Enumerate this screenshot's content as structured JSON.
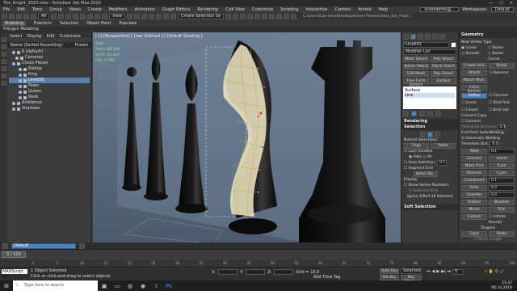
{
  "window": {
    "title": "The_Knight_2020.max - Autodesk 3ds Max 2020"
  },
  "menu": {
    "items": [
      "File",
      "Edit",
      "Tools",
      "Group",
      "Views",
      "Create",
      "Modifiers",
      "Animation",
      "Graph Editors",
      "Rendering",
      "Civil View",
      "Customize",
      "Scripting",
      "Interactive",
      "Content",
      "Arnold",
      "Help"
    ],
    "user": "andrewinfo@...",
    "workspaces_label": "Workspaces:",
    "workspace_value": "Default"
  },
  "toolbar": {
    "selection_filter": "All",
    "view_dropdown": "View",
    "create_sel_set": "Create Selection Se"
  },
  "ribbon": {
    "tabs": [
      "Modeling",
      "Freeform",
      "Selection",
      "Object Paint",
      "Populate"
    ],
    "sub": "Polygon Modeling",
    "path": "C:\\Users\\Can-Hero\\Desktop\\Chess Pieces\\Chess_Set_Final\\..."
  },
  "scene_explorer": {
    "menu": [
      "Select",
      "Display",
      "Edit",
      "Customize"
    ],
    "col_name": "Name (Sorted Ascending)",
    "col_frozen": "Frozen",
    "rows": [
      {
        "label": "0 (default)",
        "selected": false
      },
      {
        "label": "Cameras",
        "selected": false
      },
      {
        "label": "Chess Pieces",
        "selected": false
      },
      {
        "label": "Bishop",
        "selected": false
      },
      {
        "label": "King",
        "selected": false
      },
      {
        "label": "Line001",
        "selected": true
      },
      {
        "label": "Pawn",
        "selected": false
      },
      {
        "label": "Queen",
        "selected": false
      },
      {
        "label": "Rook",
        "selected": false
      },
      {
        "label": "Ambience",
        "selected": false
      },
      {
        "label": "Shadows",
        "selected": false
      }
    ],
    "layer": "Default"
  },
  "viewport": {
    "label": "[+] [Perspective] [ User Defined ] [ Default Shading ]",
    "stats": [
      {
        "k": "Total",
        "v": ""
      },
      {
        "k": "Polys:",
        "v": "88,368"
      },
      {
        "k": "Verts:",
        "v": "23,333"
      },
      {
        "k": "FPS:",
        "v": "0.795"
      }
    ]
  },
  "command_panel": {
    "object_name": "Line001",
    "modifier_list": "Modifier List",
    "buttons": [
      [
        "Mesh Select",
        "Poly Select"
      ],
      [
        "Spline Select",
        "Patch Select"
      ],
      [
        "Edit Mesh",
        "Poly Select"
      ],
      [
        "Free Form Deform",
        "Surface"
      ]
    ],
    "stack": [
      "Surface",
      "Line"
    ],
    "rendering": "Rendering",
    "selection": "Selection",
    "named_selections": "Named Selections:",
    "copy": "Copy",
    "paste": "Paste",
    "lock_handles": "Lock Handles",
    "alike": "Alike",
    "all": "All",
    "area_selection": "Area Selection:",
    "area_value": "0.1",
    "segment_end": "Segment End",
    "select_by": "Select By...",
    "display": "Display",
    "show_vertex_numbers": "Show Vertex Numbers",
    "selected_only": "Selected Only",
    "spline_info": "Spline 1/Part 16 Selected",
    "soft_selection": "Soft Selection"
  },
  "geometry_panel": {
    "title": "Geometry",
    "new_vertex_type": "New Vertex Type",
    "types": [
      "Linear",
      "Bezier",
      "Smooth",
      "Bezier Corner"
    ],
    "create_line": "Create Line",
    "break": "Break",
    "attach": "Attach",
    "reorient": "Reorient",
    "attach_mult": "Attach Mult.",
    "cross_section": "Cross Section",
    "refine": "Refine",
    "connect": "Connect",
    "linear": "Linear",
    "bind_first": "Bind first",
    "closed": "Closed",
    "bind_last": "Bind last",
    "connect_copy": "Connect Copy",
    "connect_label": "Connect",
    "threshold_label": "Threshold Distance",
    "threshold": "0.1",
    "end_point_auto_welding": "End Point Auto-Welding",
    "automatic_welding": "Automatic Welding",
    "threshold_dist": "Threshold Dist:",
    "threshold_dist_val": "6.0",
    "weld": "Weld",
    "weld_val": "0.1",
    "ops": [
      [
        "Connect",
        "Insert"
      ],
      [
        "Make First",
        "Fuse"
      ],
      [
        "Reverse",
        "Cycle"
      ],
      [
        "CrossInsert",
        "0.1"
      ],
      [
        "Fillet",
        "0.0"
      ],
      [
        "Chamfer",
        "0.0"
      ]
    ],
    "outline": "Outline",
    "boolean": "Boolean",
    "mirror": "Mirror",
    "trim": "Trim",
    "extend": "Extend",
    "infinite_bounds": "Infinite Bounds",
    "tangent": "Tangent",
    "paste_length": "Paste Length",
    "hide": "Hide",
    "unhide_all": "Unhide All",
    "bind": "Bind",
    "unbind": "Unbind",
    "delete": "Delete",
    "close": "Close",
    "divide": "Divide",
    "detach": "Detach",
    "copy": "Copy",
    "paste": "Paste"
  },
  "timeline": {
    "frame_counter": "0 / 100",
    "ticks": [
      "0",
      "5",
      "10",
      "15",
      "20",
      "25",
      "30",
      "35",
      "40",
      "45",
      "50",
      "55",
      "60",
      "65",
      "70",
      "75",
      "80",
      "85",
      "90",
      "95",
      "100"
    ]
  },
  "status": {
    "objects_selected": "1 Object Selected",
    "prompt": "Click or click-and-drag to select objects",
    "maxscript": "MAXScript Mi",
    "x_label": "X:",
    "y_label": "Y:",
    "z_label": "Z:",
    "grid": "Grid = 10.0",
    "add_time_tag": "Add Time Tag",
    "auto_key": "Auto Key",
    "set_key": "Set Key",
    "selected": "Selected",
    "key_filters": "Key Filters...",
    "frame": "0"
  },
  "taskbar": {
    "search_placeholder": "Type here to search",
    "time": "21:47",
    "date": "06.10.2019"
  },
  "colors": {
    "accent": "#4a82c0",
    "viewport_bg": "#5a6e86",
    "selected_row": "#5b7fa6"
  }
}
